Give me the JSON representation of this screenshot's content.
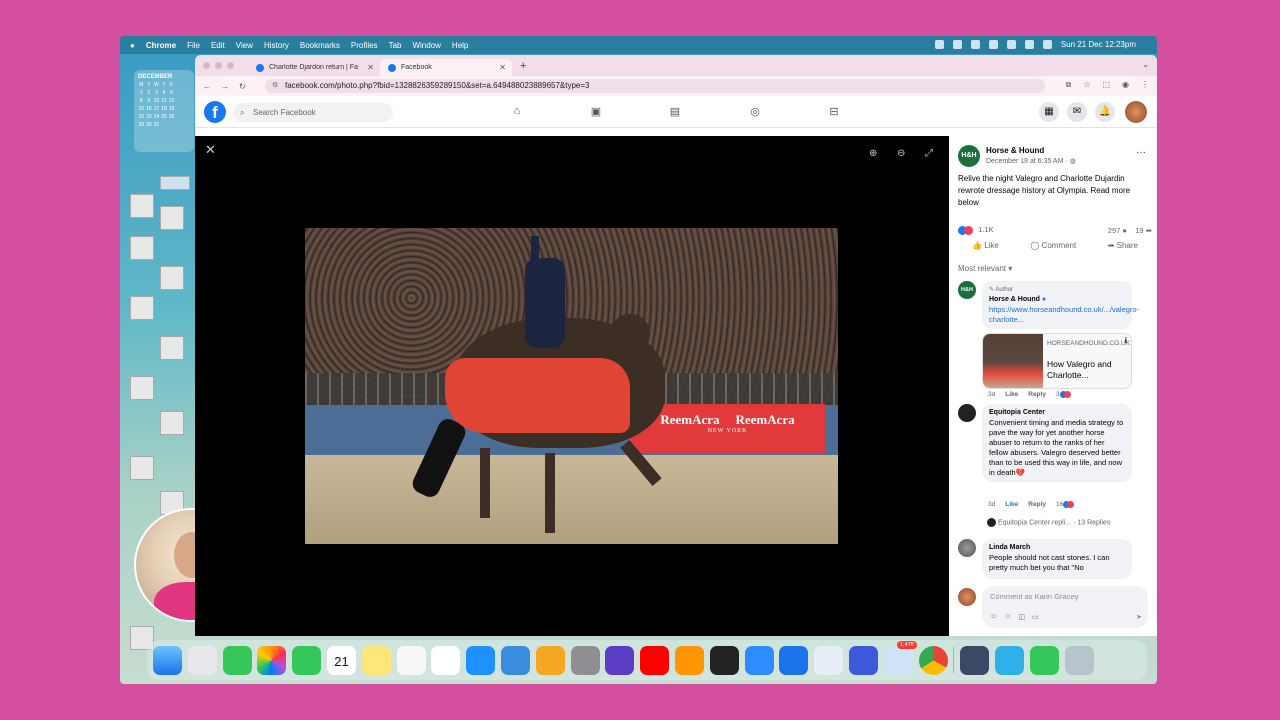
{
  "menubar": {
    "apple": "",
    "items": [
      "Chrome",
      "File",
      "Edit",
      "View",
      "History",
      "Bookmarks",
      "Profiles",
      "Tab",
      "Window",
      "Help"
    ],
    "clock": "Sun 21 Dec  12:23pm"
  },
  "calendar": {
    "month": "DECEMBER",
    "weekdays": [
      "M",
      "T",
      "W",
      "T",
      "F"
    ],
    "days": [
      "1",
      "2",
      "3",
      "4",
      "5",
      "8",
      "9",
      "10",
      "11",
      "12",
      "15",
      "16",
      "17",
      "18",
      "19",
      "22",
      "23",
      "24",
      "25",
      "26",
      "29",
      "30",
      "31"
    ]
  },
  "browser": {
    "tabs": [
      {
        "label": "Charlotte Djardon return | Fa"
      },
      {
        "label": "Facebook"
      }
    ],
    "new_tab": "+",
    "url": "facebook.com/photo.php?fbid=1328826359289150&set=a.649488023889657&type=3"
  },
  "facebook": {
    "logo": "f",
    "search_placeholder": "Search Facebook"
  },
  "post": {
    "page_logo": "H&H",
    "page_name": "Horse & Hound",
    "date": "December 18 at 6:35 AM · ",
    "text": "Relive the night Valegro and Charlotte Dujardin rewrote dressage history at Olympia. Read more below",
    "reaction_count": "1.1K",
    "comment_count": "297",
    "share_count": "19",
    "like_label": "Like",
    "comment_label": "Comment",
    "share_label": "Share",
    "sort_label": "Most relevant"
  },
  "comments": [
    {
      "badge": "Author",
      "author": "Horse & Hound",
      "link": "https://www.horseandhound.co.uk/.../valegro-charlotte...",
      "card_domain": "HORSEANDHOUND.CO.UK",
      "card_title": "How Valegro and Charlotte...",
      "time": "3d",
      "like": "Like",
      "reply": "Reply",
      "reactions": "3"
    },
    {
      "author": "Equitopia Center",
      "text": "Convenient timing and media strategy to pave the way for yet another horse abuser to return to the ranks of her fellow abusers. Valegro deserved better than to be used this way in life, and now in death💔",
      "time": "3d",
      "like": "Like",
      "reply": "Reply",
      "reactions": "16",
      "replies_preview": "Equitopia Center repli...",
      "replies_count": "· 13 Replies"
    },
    {
      "author": "Linda March",
      "text": "People should not cast stones. I can pretty much bet you that \"No"
    }
  ],
  "compose": {
    "placeholder": "Comment as Karin Gracey"
  },
  "photo": {
    "banner_brand": "ReemAcra",
    "banner_sub": "NEW YORK"
  },
  "dock": {
    "calendar_day": "21",
    "mail_badge": "1,478"
  }
}
